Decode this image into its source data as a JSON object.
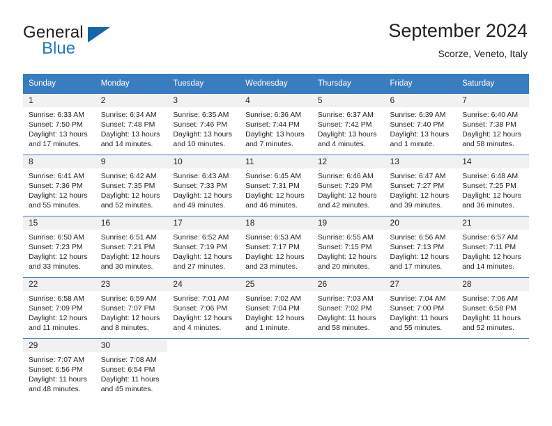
{
  "brand": {
    "name_part1": "General",
    "name_part2": "Blue",
    "triangle_color": "#1565a8",
    "blue_text_color": "#2176bd"
  },
  "header": {
    "title": "September 2024",
    "subtitle": "Scorze, Veneto, Italy"
  },
  "theme": {
    "header_row_bg": "#3a7cc0",
    "header_row_text": "#ffffff",
    "day_number_bg": "#f1f1f1",
    "row_divider": "#3a7cc0",
    "body_text": "#231f20"
  },
  "calendar": {
    "weekday_headers": [
      "Sunday",
      "Monday",
      "Tuesday",
      "Wednesday",
      "Thursday",
      "Friday",
      "Saturday"
    ],
    "weeks": [
      [
        {
          "day": "1",
          "sunrise": "Sunrise: 6:33 AM",
          "sunset": "Sunset: 7:50 PM",
          "daylight_line1": "Daylight: 13 hours",
          "daylight_line2": "and 17 minutes."
        },
        {
          "day": "2",
          "sunrise": "Sunrise: 6:34 AM",
          "sunset": "Sunset: 7:48 PM",
          "daylight_line1": "Daylight: 13 hours",
          "daylight_line2": "and 14 minutes."
        },
        {
          "day": "3",
          "sunrise": "Sunrise: 6:35 AM",
          "sunset": "Sunset: 7:46 PM",
          "daylight_line1": "Daylight: 13 hours",
          "daylight_line2": "and 10 minutes."
        },
        {
          "day": "4",
          "sunrise": "Sunrise: 6:36 AM",
          "sunset": "Sunset: 7:44 PM",
          "daylight_line1": "Daylight: 13 hours",
          "daylight_line2": "and 7 minutes."
        },
        {
          "day": "5",
          "sunrise": "Sunrise: 6:37 AM",
          "sunset": "Sunset: 7:42 PM",
          "daylight_line1": "Daylight: 13 hours",
          "daylight_line2": "and 4 minutes."
        },
        {
          "day": "6",
          "sunrise": "Sunrise: 6:39 AM",
          "sunset": "Sunset: 7:40 PM",
          "daylight_line1": "Daylight: 13 hours",
          "daylight_line2": "and 1 minute."
        },
        {
          "day": "7",
          "sunrise": "Sunrise: 6:40 AM",
          "sunset": "Sunset: 7:38 PM",
          "daylight_line1": "Daylight: 12 hours",
          "daylight_line2": "and 58 minutes."
        }
      ],
      [
        {
          "day": "8",
          "sunrise": "Sunrise: 6:41 AM",
          "sunset": "Sunset: 7:36 PM",
          "daylight_line1": "Daylight: 12 hours",
          "daylight_line2": "and 55 minutes."
        },
        {
          "day": "9",
          "sunrise": "Sunrise: 6:42 AM",
          "sunset": "Sunset: 7:35 PM",
          "daylight_line1": "Daylight: 12 hours",
          "daylight_line2": "and 52 minutes."
        },
        {
          "day": "10",
          "sunrise": "Sunrise: 6:43 AM",
          "sunset": "Sunset: 7:33 PM",
          "daylight_line1": "Daylight: 12 hours",
          "daylight_line2": "and 49 minutes."
        },
        {
          "day": "11",
          "sunrise": "Sunrise: 6:45 AM",
          "sunset": "Sunset: 7:31 PM",
          "daylight_line1": "Daylight: 12 hours",
          "daylight_line2": "and 46 minutes."
        },
        {
          "day": "12",
          "sunrise": "Sunrise: 6:46 AM",
          "sunset": "Sunset: 7:29 PM",
          "daylight_line1": "Daylight: 12 hours",
          "daylight_line2": "and 42 minutes."
        },
        {
          "day": "13",
          "sunrise": "Sunrise: 6:47 AM",
          "sunset": "Sunset: 7:27 PM",
          "daylight_line1": "Daylight: 12 hours",
          "daylight_line2": "and 39 minutes."
        },
        {
          "day": "14",
          "sunrise": "Sunrise: 6:48 AM",
          "sunset": "Sunset: 7:25 PM",
          "daylight_line1": "Daylight: 12 hours",
          "daylight_line2": "and 36 minutes."
        }
      ],
      [
        {
          "day": "15",
          "sunrise": "Sunrise: 6:50 AM",
          "sunset": "Sunset: 7:23 PM",
          "daylight_line1": "Daylight: 12 hours",
          "daylight_line2": "and 33 minutes."
        },
        {
          "day": "16",
          "sunrise": "Sunrise: 6:51 AM",
          "sunset": "Sunset: 7:21 PM",
          "daylight_line1": "Daylight: 12 hours",
          "daylight_line2": "and 30 minutes."
        },
        {
          "day": "17",
          "sunrise": "Sunrise: 6:52 AM",
          "sunset": "Sunset: 7:19 PM",
          "daylight_line1": "Daylight: 12 hours",
          "daylight_line2": "and 27 minutes."
        },
        {
          "day": "18",
          "sunrise": "Sunrise: 6:53 AM",
          "sunset": "Sunset: 7:17 PM",
          "daylight_line1": "Daylight: 12 hours",
          "daylight_line2": "and 23 minutes."
        },
        {
          "day": "19",
          "sunrise": "Sunrise: 6:55 AM",
          "sunset": "Sunset: 7:15 PM",
          "daylight_line1": "Daylight: 12 hours",
          "daylight_line2": "and 20 minutes."
        },
        {
          "day": "20",
          "sunrise": "Sunrise: 6:56 AM",
          "sunset": "Sunset: 7:13 PM",
          "daylight_line1": "Daylight: 12 hours",
          "daylight_line2": "and 17 minutes."
        },
        {
          "day": "21",
          "sunrise": "Sunrise: 6:57 AM",
          "sunset": "Sunset: 7:11 PM",
          "daylight_line1": "Daylight: 12 hours",
          "daylight_line2": "and 14 minutes."
        }
      ],
      [
        {
          "day": "22",
          "sunrise": "Sunrise: 6:58 AM",
          "sunset": "Sunset: 7:09 PM",
          "daylight_line1": "Daylight: 12 hours",
          "daylight_line2": "and 11 minutes."
        },
        {
          "day": "23",
          "sunrise": "Sunrise: 6:59 AM",
          "sunset": "Sunset: 7:07 PM",
          "daylight_line1": "Daylight: 12 hours",
          "daylight_line2": "and 8 minutes."
        },
        {
          "day": "24",
          "sunrise": "Sunrise: 7:01 AM",
          "sunset": "Sunset: 7:06 PM",
          "daylight_line1": "Daylight: 12 hours",
          "daylight_line2": "and 4 minutes."
        },
        {
          "day": "25",
          "sunrise": "Sunrise: 7:02 AM",
          "sunset": "Sunset: 7:04 PM",
          "daylight_line1": "Daylight: 12 hours",
          "daylight_line2": "and 1 minute."
        },
        {
          "day": "26",
          "sunrise": "Sunrise: 7:03 AM",
          "sunset": "Sunset: 7:02 PM",
          "daylight_line1": "Daylight: 11 hours",
          "daylight_line2": "and 58 minutes."
        },
        {
          "day": "27",
          "sunrise": "Sunrise: 7:04 AM",
          "sunset": "Sunset: 7:00 PM",
          "daylight_line1": "Daylight: 11 hours",
          "daylight_line2": "and 55 minutes."
        },
        {
          "day": "28",
          "sunrise": "Sunrise: 7:06 AM",
          "sunset": "Sunset: 6:58 PM",
          "daylight_line1": "Daylight: 11 hours",
          "daylight_line2": "and 52 minutes."
        }
      ],
      [
        {
          "day": "29",
          "sunrise": "Sunrise: 7:07 AM",
          "sunset": "Sunset: 6:56 PM",
          "daylight_line1": "Daylight: 11 hours",
          "daylight_line2": "and 48 minutes."
        },
        {
          "day": "30",
          "sunrise": "Sunrise: 7:08 AM",
          "sunset": "Sunset: 6:54 PM",
          "daylight_line1": "Daylight: 11 hours",
          "daylight_line2": "and 45 minutes."
        },
        {
          "day": "",
          "sunrise": "",
          "sunset": "",
          "daylight_line1": "",
          "daylight_line2": ""
        },
        {
          "day": "",
          "sunrise": "",
          "sunset": "",
          "daylight_line1": "",
          "daylight_line2": ""
        },
        {
          "day": "",
          "sunrise": "",
          "sunset": "",
          "daylight_line1": "",
          "daylight_line2": ""
        },
        {
          "day": "",
          "sunrise": "",
          "sunset": "",
          "daylight_line1": "",
          "daylight_line2": ""
        },
        {
          "day": "",
          "sunrise": "",
          "sunset": "",
          "daylight_line1": "",
          "daylight_line2": ""
        }
      ]
    ]
  }
}
